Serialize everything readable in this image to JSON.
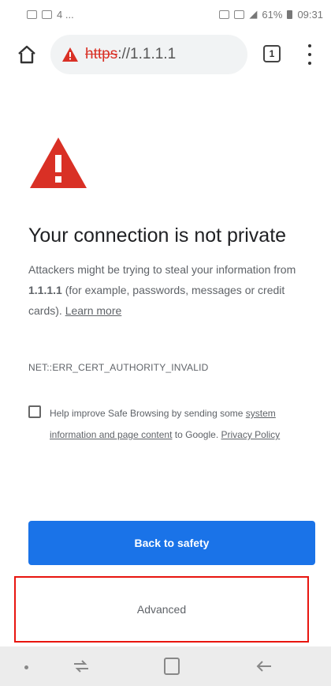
{
  "status_bar": {
    "battery_percent": "61%",
    "time": "09:31",
    "left_indicator": "4 ..."
  },
  "toolbar": {
    "url_scheme": "https",
    "url_rest": "://1.1.1.1",
    "tab_count": "1"
  },
  "page": {
    "heading": "Your connection is not private",
    "desc_part1": "Attackers might be trying to steal your information from ",
    "desc_host": "1.1.1.1",
    "desc_part2": " (for example, passwords, messages or credit cards). ",
    "learn_more": "Learn more",
    "error_code": "NET::ERR_CERT_AUTHORITY_INVALID",
    "checkbox_text_1": "Help improve Safe Browsing by sending some ",
    "checkbox_link": "system information and page content",
    "checkbox_text_2": " to Google. ",
    "privacy_policy": "Privacy Policy"
  },
  "buttons": {
    "back_to_safety": "Back to safety",
    "advanced": "Advanced"
  },
  "colors": {
    "warning_red": "#d93025",
    "primary_blue": "#1a73e8",
    "highlight_box": "#e8150f"
  }
}
